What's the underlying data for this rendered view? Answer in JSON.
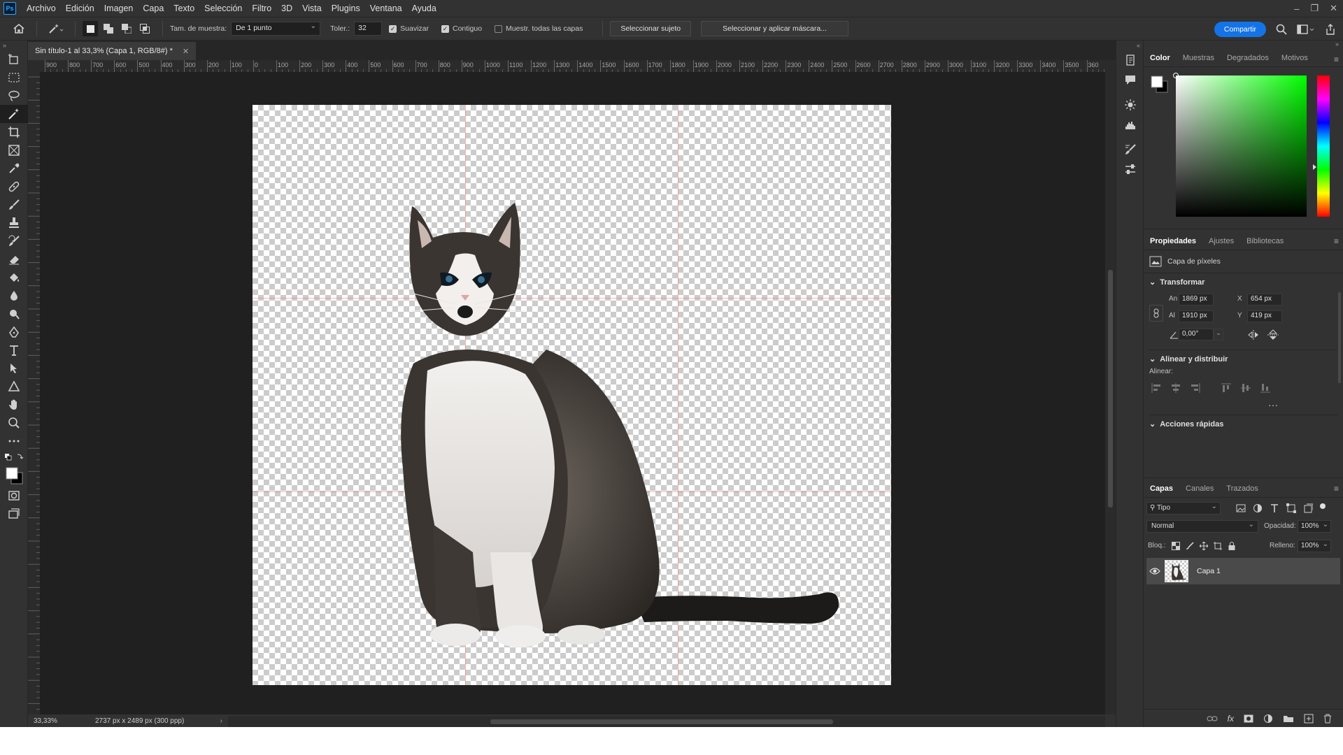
{
  "menu": [
    "Archivo",
    "Edición",
    "Imagen",
    "Capa",
    "Texto",
    "Selección",
    "Filtro",
    "3D",
    "Vista",
    "Plugins",
    "Ventana",
    "Ayuda"
  ],
  "app_logo": "Ps",
  "options": {
    "sample_size_label": "Tam. de muestra:",
    "sample_size_value": "De 1 punto",
    "tolerance_label": "Toler.:",
    "tolerance_value": "32",
    "antialias_label": "Suavizar",
    "contiguous_label": "Contiguo",
    "sample_all_label": "Muestr. todas las capas",
    "select_subject": "Seleccionar sujeto",
    "select_mask": "Seleccionar y aplicar máscara...",
    "share": "Compartir"
  },
  "document": {
    "tab_title": "Sin título-1 al 33,3% (Capa 1, RGB/8#) *",
    "zoom": "33,33%",
    "info": "2737 px x 2489 px (300 ppp)"
  },
  "ruler_ticks": [
    "900",
    "800",
    "700",
    "600",
    "500",
    "400",
    "300",
    "200",
    "100",
    "0",
    "100",
    "200",
    "300",
    "400",
    "500",
    "600",
    "700",
    "800",
    "900",
    "1000",
    "1100",
    "1200",
    "1300",
    "1400",
    "1500",
    "1600",
    "1700",
    "1800",
    "1900",
    "2000",
    "2100",
    "2200",
    "2300",
    "2400",
    "2500",
    "2600",
    "2700",
    "2800",
    "2900",
    "3000",
    "3100",
    "3200",
    "3300",
    "3400",
    "3500",
    "360"
  ],
  "color_panel": {
    "tabs": [
      "Color",
      "Muestras",
      "Degradados",
      "Motivos"
    ],
    "hue_marker_fraction": 0.65
  },
  "properties_panel": {
    "tabs": [
      "Propiedades",
      "Ajustes",
      "Bibliotecas"
    ],
    "layer_type": "Capa de píxeles",
    "transform_title": "Transformar",
    "width_label": "An",
    "width_value": "1869 px",
    "height_label": "Al",
    "height_value": "1910 px",
    "x_label": "X",
    "x_value": "654 px",
    "y_label": "Y",
    "y_value": "419 px",
    "angle_value": "0,00°",
    "align_title": "Alinear y distribuir",
    "align_label": "Alinear:",
    "quick_actions_title": "Acciones rápidas"
  },
  "layers_panel": {
    "tabs": [
      "Capas",
      "Canales",
      "Trazados"
    ],
    "filter_placeholder": "Tipo",
    "blend_mode": "Normal",
    "opacity_label": "Opacidad:",
    "opacity_value": "100%",
    "lock_label": "Bloq.:",
    "fill_label": "Relleno:",
    "fill_value": "100%",
    "layers": [
      {
        "name": "Capa 1",
        "visible": true
      }
    ]
  },
  "colors": {
    "accent": "#1473e6",
    "panel_bg": "#323232",
    "pasteboard": "#202020"
  }
}
